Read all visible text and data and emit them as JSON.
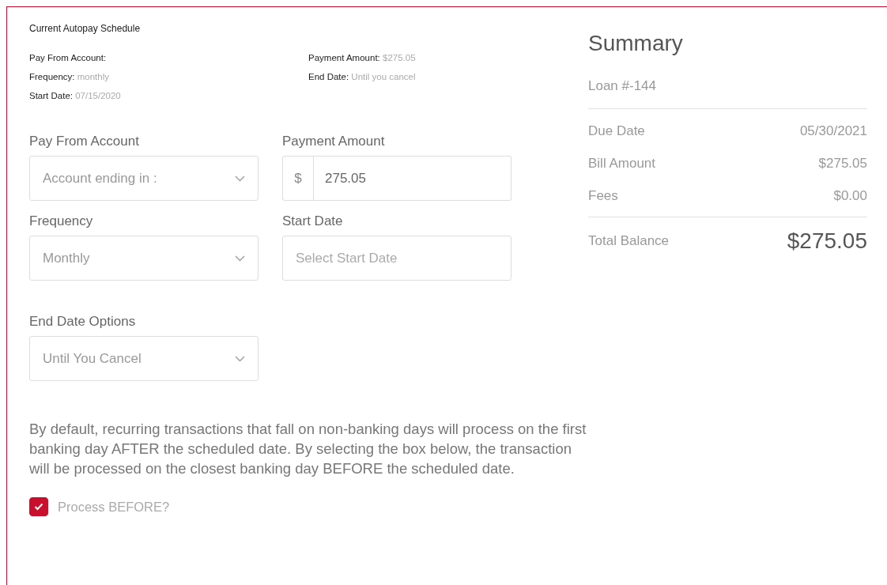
{
  "current_schedule": {
    "title": "Current Autopay Schedule",
    "left": [
      {
        "label": "Pay From Account:"
      },
      {
        "label": "Frequency:",
        "value": "monthly"
      },
      {
        "label": "Start Date:",
        "value": "07/15/2020"
      }
    ],
    "right": [
      {
        "label": "Payment Amount:",
        "value": "$275.05"
      },
      {
        "label": "End Date:",
        "value": "Until you cancel"
      }
    ]
  },
  "form": [
    {
      "label": "Pay From Account",
      "kind": "select",
      "value": "Account ending in :"
    },
    {
      "label": "Payment Amount",
      "kind": "amount",
      "prefix": "$",
      "value": "275.05"
    },
    {
      "label": "Frequency",
      "kind": "select",
      "value": "Monthly"
    },
    {
      "label": "Start Date",
      "kind": "date",
      "placeholder": "Select Start Date"
    },
    {
      "label": "End Date Options",
      "kind": "select",
      "value": "Until You Cancel"
    }
  ],
  "notice": "By default, recurring transactions that fall on non-banking days will process on the first banking day AFTER the scheduled date. By selecting the box below, the transaction will be processed on the closest banking day BEFORE the scheduled date.",
  "process_before": {
    "label": "Process BEFORE?",
    "checked": true
  },
  "summary": {
    "title": "Summary",
    "loan": "Loan #-144",
    "rows": [
      {
        "label": "Due Date",
        "value": "05/30/2021"
      },
      {
        "label": "Bill Amount",
        "value": "$275.05"
      },
      {
        "label": "Fees",
        "value": "$0.00"
      }
    ],
    "total": {
      "label": "Total Balance",
      "value": "$275.05"
    }
  }
}
